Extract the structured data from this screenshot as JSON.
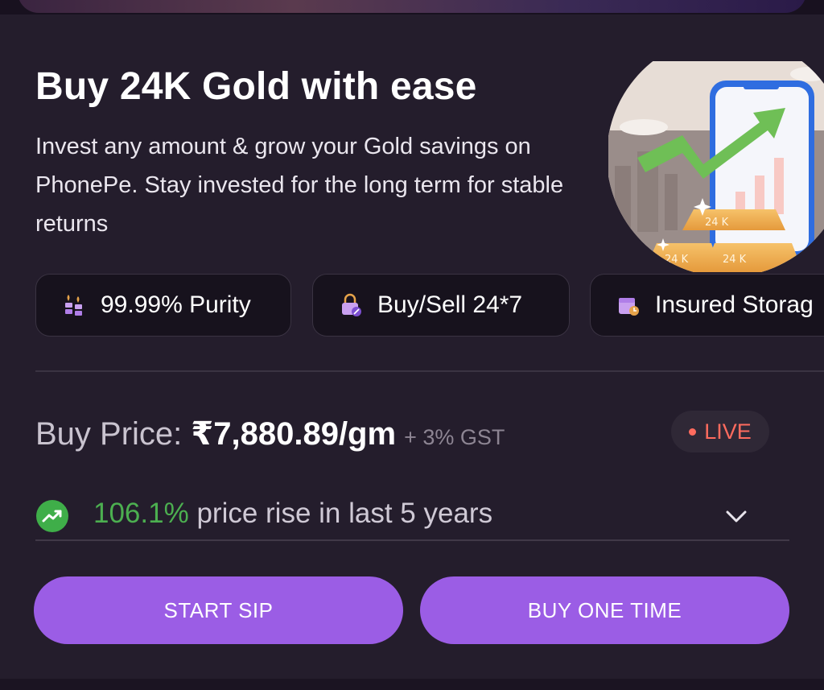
{
  "hero": {
    "title": "Buy 24K Gold with ease",
    "description": "Invest any amount & grow your Gold savings on PhonePe. Stay invested for the long term for stable returns",
    "illustration_text": [
      "24 K",
      "24 K",
      "24 K"
    ]
  },
  "features": [
    {
      "label": "99.99% Purity",
      "icon": "gold-stack-icon"
    },
    {
      "label": "Buy/Sell 24*7",
      "icon": "lock-clock-icon"
    },
    {
      "label": "Insured Storag",
      "icon": "insured-box-icon"
    }
  ],
  "price": {
    "label": "Buy Price: ",
    "value": "₹7,880.89/gm",
    "gst": "+ 3% GST",
    "live": "LIVE"
  },
  "rise": {
    "percent": "106.1%",
    "text": " price rise in last 5 years"
  },
  "buttons": {
    "start_sip": "START SIP",
    "buy_one_time": "BUY ONE TIME"
  },
  "colors": {
    "accent": "#9b5de5",
    "live": "#ff6b5e",
    "rise": "#4caf50",
    "background": "#241d2c"
  }
}
